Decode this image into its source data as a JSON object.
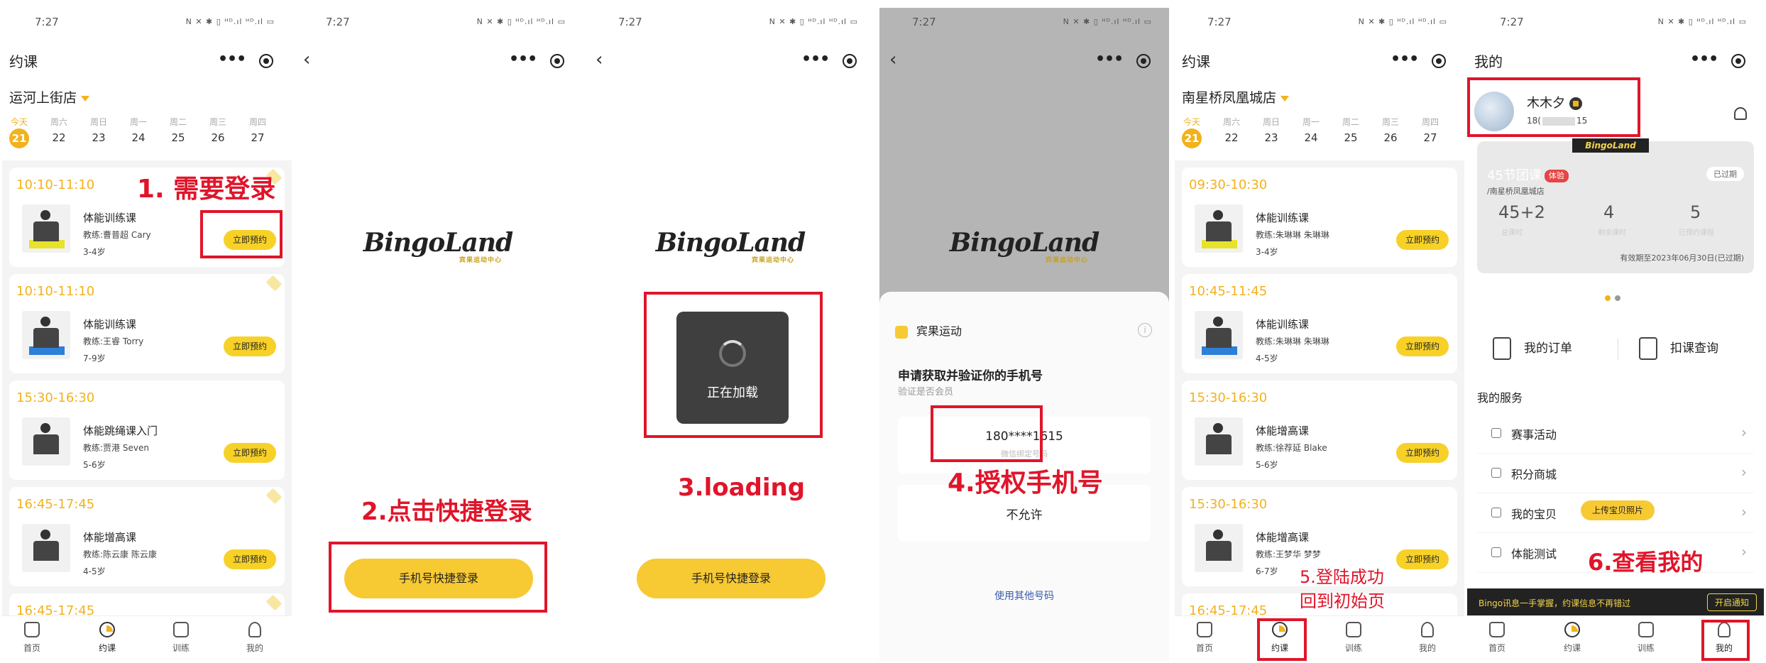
{
  "status": {
    "time": "7:27",
    "icons": "N ✕ ✱ ▯ ᴴᴰ.ıl ᴴᴰ.ıl ▭"
  },
  "tabs": [
    "首页",
    "约课",
    "训练",
    "我的"
  ],
  "p1": {
    "title": "约课",
    "store": "运河上街店",
    "week": [
      [
        "今天",
        "21"
      ],
      [
        "周六",
        "22"
      ],
      [
        "周日",
        "23"
      ],
      [
        "周一",
        "24"
      ],
      [
        "周二",
        "25"
      ],
      [
        "周三",
        "26"
      ],
      [
        "周四",
        "27"
      ]
    ],
    "cards": [
      {
        "time": "10:10-11:10",
        "name": "体能训练课",
        "coach": "教练:曹普超 Cary",
        "age": "3-4岁",
        "btn": "立即预约"
      },
      {
        "time": "10:10-11:10",
        "name": "体能训练课",
        "coach": "教练:王睿 Torry",
        "age": "7-9岁",
        "btn": "立即预约"
      },
      {
        "time": "15:30-16:30",
        "name": "体能跳绳课入门",
        "coach": "教练:贾港 Seven",
        "age": "5-6岁",
        "btn": "立即预约"
      },
      {
        "time": "16:45-17:45",
        "name": "体能增高课",
        "coach": "教练:陈云康 陈云康",
        "age": "4-5岁",
        "btn": "立即预约"
      },
      {
        "time": "16:45-17:45"
      }
    ],
    "annot": "1. 需要登录"
  },
  "p2": {
    "logo": "BingoLand",
    "logo_sub": "宾果运动中心",
    "btn": "手机号快捷登录",
    "annot": "2.点击快捷登录"
  },
  "p3": {
    "logo": "BingoLand",
    "logo_sub": "宾果运动中心",
    "loading": "正在加载",
    "btn": "手机号快捷登录",
    "annot": "3.loading"
  },
  "p4": {
    "logo": "BingoLand",
    "logo_sub": "宾果运动中心",
    "app": "宾果运动",
    "info": "i",
    "heading": "申请获取并验证你的手机号",
    "sub": "验证是否会员",
    "phone": "180****1615",
    "phone_sub": "微信绑定号码",
    "deny": "不允许",
    "other": "使用其他号码",
    "annot": "4.授权手机号"
  },
  "p5": {
    "title": "约课",
    "store": "南星桥凤凰城店",
    "week": [
      [
        "今天",
        "21"
      ],
      [
        "周六",
        "22"
      ],
      [
        "周日",
        "23"
      ],
      [
        "周一",
        "24"
      ],
      [
        "周二",
        "25"
      ],
      [
        "周三",
        "26"
      ],
      [
        "周四",
        "27"
      ]
    ],
    "cards": [
      {
        "time": "09:30-10:30",
        "name": "体能训练课",
        "coach": "教练:朱琳琳 朱琳琳",
        "age": "3-4岁",
        "btn": "立即预约"
      },
      {
        "time": "10:45-11:45",
        "name": "体能训练课",
        "coach": "教练:朱琳琳 朱琳琳",
        "age": "4-5岁",
        "btn": "立即预约"
      },
      {
        "time": "15:30-16:30",
        "name": "体能增高课",
        "coach": "教练:徐荐延 Blake",
        "age": "5-6岁",
        "btn": "立即预约"
      },
      {
        "time": "15:30-16:30",
        "name": "体能增高课",
        "coach": "教练:王梦华 梦梦",
        "age": "6-7岁",
        "btn": "立即预约"
      },
      {
        "time": "16:45-17:45"
      }
    ],
    "annot1": "5.登陆成功",
    "annot2": "回到初始页"
  },
  "p6": {
    "title": "我的",
    "name": "木木夕",
    "phone_a": "18(",
    "phone_b": "15",
    "card": {
      "tag": "BingoLand",
      "title": "45节团课",
      "badge": "体验",
      "store": "/南星桥凤凰城店",
      "expired": "已过期",
      "n1": "45+2",
      "l1": "总课时",
      "n2": "4",
      "l2": "剩余课时",
      "n3": "5",
      "l3": "已预约课程",
      "valid": "有效期至2023年06月30日(已过期)"
    },
    "orders": "我的订单",
    "query": "扣课查询",
    "services_title": "我的服务",
    "services": [
      "赛事活动",
      "积分商城",
      "我的宝贝",
      "体能测试"
    ],
    "upload": "上传宝贝照片",
    "notice": "Bingo讯息一手掌握，约课信息不再错过",
    "notice_btn": "开启通知",
    "annot": "6.查看我的"
  },
  "colors": {
    "accent": "#f2b21c",
    "button": "#f7d128",
    "annotation": "#e0152a"
  }
}
